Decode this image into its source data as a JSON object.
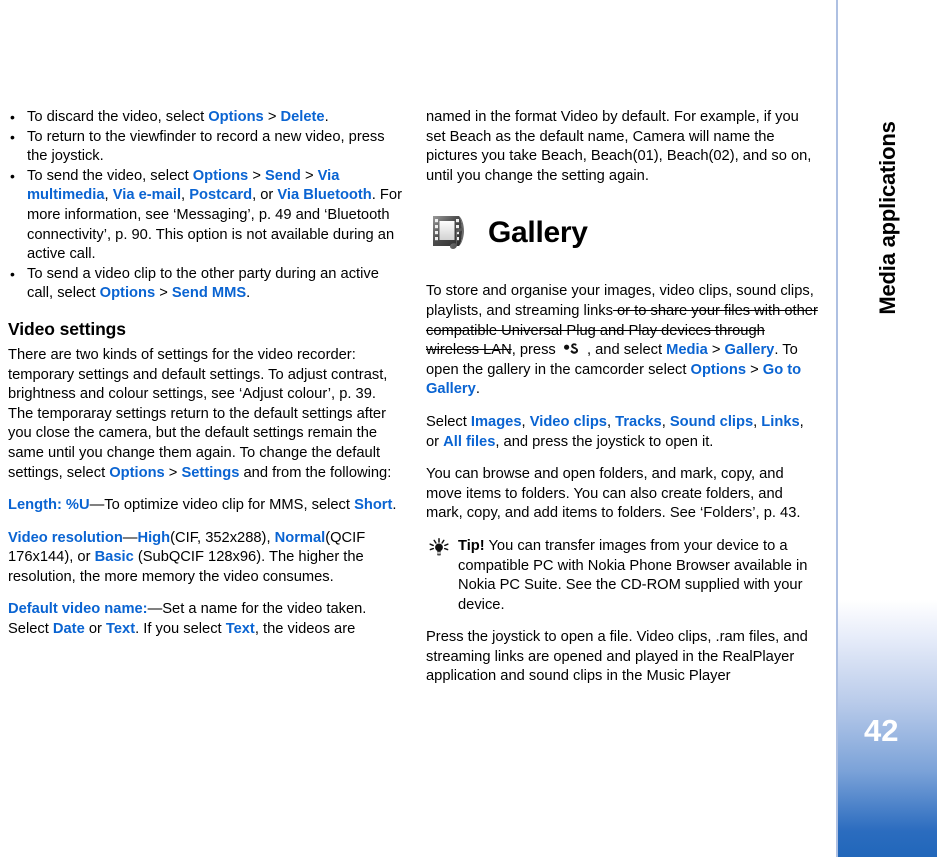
{
  "sidebar": {
    "chapter_label": "Media applications",
    "page_number": "42",
    "accent_color": "#2167ba",
    "border_color": "#aec0e2"
  },
  "link_color": "#0a64d2",
  "left_column": {
    "bullets": [
      {
        "id": "discard-video",
        "parts": [
          {
            "t": "To discard the video, select ",
            "s": "plain"
          },
          {
            "t": "Options",
            "s": "link"
          },
          {
            "t": " > ",
            "s": "plain"
          },
          {
            "t": "Delete",
            "s": "link"
          },
          {
            "t": ".",
            "s": "plain"
          }
        ]
      },
      {
        "id": "return-viewfinder",
        "parts": [
          {
            "t": "To return to the viewfinder to record a new video, press the joystick.",
            "s": "plain"
          }
        ]
      },
      {
        "id": "send-video",
        "parts": [
          {
            "t": "To send the video, select ",
            "s": "plain"
          },
          {
            "t": "Options",
            "s": "link"
          },
          {
            "t": " > ",
            "s": "plain"
          },
          {
            "t": "Send",
            "s": "link"
          },
          {
            "t": " > ",
            "s": "plain"
          },
          {
            "t": "Via multimedia",
            "s": "link"
          },
          {
            "t": ", ",
            "s": "plain"
          },
          {
            "t": "Via e-mail",
            "s": "link"
          },
          {
            "t": ", ",
            "s": "plain"
          },
          {
            "t": "Postcard",
            "s": "link"
          },
          {
            "t": ", or ",
            "s": "plain"
          },
          {
            "t": "Via Bluetooth",
            "s": "link"
          },
          {
            "t": ". For more information, see ‘Messaging’, p. 49 and ‘Bluetooth connectivity’, p. 90. This option is not available during an active call.",
            "s": "plain"
          }
        ]
      },
      {
        "id": "send-video-clip-active-call",
        "parts": [
          {
            "t": "To send a video clip to the other party during an active call, select ",
            "s": "plain"
          },
          {
            "t": "Options",
            "s": "link"
          },
          {
            "t": " > ",
            "s": "plain"
          },
          {
            "t": "Send MMS",
            "s": "link"
          },
          {
            "t": ".",
            "s": "plain"
          }
        ]
      }
    ],
    "section_heading": "Video settings",
    "intro_paragraph": [
      {
        "t": "There are two kinds of settings for the video recorder: temporary settings and default settings. To adjust contrast, brightness and colour settings, see ‘Adjust colour’, p. 39. The temporaray settings return to the default settings after you close the camera, but the default settings remain the same until you change them again. To change the default settings, select ",
        "s": "plain"
      },
      {
        "t": "Options",
        "s": "link"
      },
      {
        "t": " > ",
        "s": "plain"
      },
      {
        "t": "Settings",
        "s": "link"
      },
      {
        "t": " and from the following:",
        "s": "plain"
      }
    ],
    "settings": [
      {
        "id": "length-setting",
        "parts": [
          {
            "t": "Length: %U",
            "s": "link"
          },
          {
            "t": "—To optimize video clip for MMS, select ",
            "s": "plain"
          },
          {
            "t": "Short",
            "s": "link"
          },
          {
            "t": ".",
            "s": "plain"
          }
        ]
      },
      {
        "id": "video-resolution-setting",
        "parts": [
          {
            "t": "Video resolution",
            "s": "link"
          },
          {
            "t": "—",
            "s": "plain"
          },
          {
            "t": "High",
            "s": "link"
          },
          {
            "t": "(CIF, 352x288), ",
            "s": "plain"
          },
          {
            "t": "Normal",
            "s": "link"
          },
          {
            "t": "(QCIF 176x144), or ",
            "s": "plain"
          },
          {
            "t": "Basic",
            "s": "link"
          },
          {
            "t": " (SubQCIF 128x96). The higher the resolution, the more memory the video consumes.",
            "s": "plain"
          }
        ]
      },
      {
        "id": "default-video-name-setting",
        "parts": [
          {
            "t": "Default video name:",
            "s": "link"
          },
          {
            "t": "—Set a name for the video taken. Select ",
            "s": "plain"
          },
          {
            "t": "Date",
            "s": "link"
          },
          {
            "t": " or ",
            "s": "plain"
          },
          {
            "t": "Text",
            "s": "link"
          },
          {
            "t": ". If you select ",
            "s": "plain"
          },
          {
            "t": "Text",
            "s": "link"
          },
          {
            "t": ", the videos are",
            "s": "plain"
          }
        ]
      }
    ]
  },
  "right_column": {
    "continuation_paragraph": [
      {
        "t": "named in the format Video by default. For example, if you set Beach as the default name, Camera will name the pictures you take Beach, Beach(01), Beach(02), and so on, until you change the setting again.",
        "s": "plain"
      }
    ],
    "gallery_heading": "Gallery",
    "gallery_icon": "filmstrip-music-icon",
    "intro_paragraph": [
      {
        "t": "To store and organise your images, video clips, sound clips, playlists, and streaming links",
        "s": "plain"
      },
      {
        "t": " or to share your files with other compatible Universal Plug and Play devices through wireless LAN",
        "s": "strike"
      },
      {
        "t": ", press ",
        "s": "plain"
      },
      {
        "t": "MENUKEY",
        "s": "glyph"
      },
      {
        "t": " , and select ",
        "s": "plain"
      },
      {
        "t": "Media",
        "s": "link"
      },
      {
        "t": " > ",
        "s": "plain"
      },
      {
        "t": "Gallery",
        "s": "link"
      },
      {
        "t": ". To open the gallery in the camcorder select ",
        "s": "plain"
      },
      {
        "t": "Options",
        "s": "link"
      },
      {
        "t": " > ",
        "s": "plain"
      },
      {
        "t": "Go to Gallery",
        "s": "link"
      },
      {
        "t": ".",
        "s": "plain"
      }
    ],
    "select_paragraph": [
      {
        "t": "Select ",
        "s": "plain"
      },
      {
        "t": "Images",
        "s": "link"
      },
      {
        "t": ", ",
        "s": "plain"
      },
      {
        "t": "Video clips",
        "s": "link"
      },
      {
        "t": ", ",
        "s": "plain"
      },
      {
        "t": "Tracks",
        "s": "link"
      },
      {
        "t": ", ",
        "s": "plain"
      },
      {
        "t": "Sound clips",
        "s": "link"
      },
      {
        "t": ", ",
        "s": "plain"
      },
      {
        "t": "Links",
        "s": "link"
      },
      {
        "t": ", or ",
        "s": "plain"
      },
      {
        "t": "All files",
        "s": "link"
      },
      {
        "t": ", and press the joystick to open it.",
        "s": "plain"
      }
    ],
    "browse_paragraph": [
      {
        "t": "You can browse and open folders, and mark, copy, and move items to folders. You can also create folders, and mark, copy, and add items to folders. See ‘Folders’, p. 43.",
        "s": "plain"
      }
    ],
    "tip": {
      "icon": "lightbulb-icon",
      "label": "Tip!",
      "text": " You can transfer images from your device to a compatible PC with Nokia Phone Browser available in Nokia PC Suite. See the CD-ROM supplied with your device."
    },
    "closing_paragraph": [
      {
        "t": "Press the joystick to open a file. Video clips, .ram files, and streaming links are opened and played in the RealPlayer application and sound clips in the Music Player",
        "s": "plain"
      }
    ]
  }
}
